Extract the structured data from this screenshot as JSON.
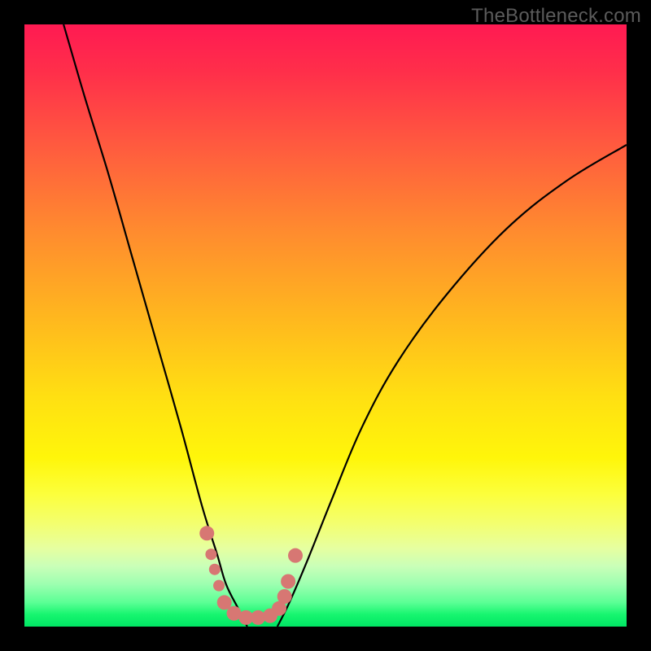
{
  "watermark": "TheBottleneck.com",
  "colors": {
    "frame": "#000000",
    "curve": "#000000",
    "dots": "#d77773",
    "gradient_top": "#ff1a52",
    "gradient_bottom": "#00e664"
  },
  "chart_data": {
    "type": "line",
    "title": "",
    "xlabel": "",
    "ylabel": "",
    "xlim": [
      0,
      1
    ],
    "ylim": [
      0,
      1
    ],
    "note": "No axis ticks or labels visible; values are normalized plot-area fractions (0,0 at bottom-left). Two curves descend into a V-shaped minimum near x≈0.35–0.42 at y≈0. Left curve falls steeply from top-left; right curve rises toward upper-right with decreasing slope.",
    "series": [
      {
        "name": "left-branch",
        "x": [
          0.065,
          0.1,
          0.14,
          0.18,
          0.22,
          0.26,
          0.295,
          0.32,
          0.335,
          0.355,
          0.37
        ],
        "y": [
          1.0,
          0.88,
          0.75,
          0.61,
          0.47,
          0.33,
          0.2,
          0.12,
          0.07,
          0.03,
          0.0
        ]
      },
      {
        "name": "right-branch",
        "x": [
          0.42,
          0.44,
          0.47,
          0.51,
          0.56,
          0.62,
          0.7,
          0.8,
          0.9,
          1.0
        ],
        "y": [
          0.0,
          0.04,
          0.11,
          0.21,
          0.33,
          0.44,
          0.55,
          0.66,
          0.74,
          0.8
        ]
      }
    ],
    "markers": [
      {
        "x": 0.303,
        "y": 0.155,
        "r": 9
      },
      {
        "x": 0.31,
        "y": 0.12,
        "r": 7
      },
      {
        "x": 0.316,
        "y": 0.095,
        "r": 7
      },
      {
        "x": 0.323,
        "y": 0.068,
        "r": 7
      },
      {
        "x": 0.332,
        "y": 0.04,
        "r": 9
      },
      {
        "x": 0.348,
        "y": 0.022,
        "r": 9
      },
      {
        "x": 0.368,
        "y": 0.015,
        "r": 9
      },
      {
        "x": 0.388,
        "y": 0.015,
        "r": 9
      },
      {
        "x": 0.408,
        "y": 0.018,
        "r": 9
      },
      {
        "x": 0.423,
        "y": 0.03,
        "r": 9
      },
      {
        "x": 0.432,
        "y": 0.05,
        "r": 9
      },
      {
        "x": 0.438,
        "y": 0.075,
        "r": 9
      },
      {
        "x": 0.45,
        "y": 0.118,
        "r": 9
      }
    ]
  }
}
